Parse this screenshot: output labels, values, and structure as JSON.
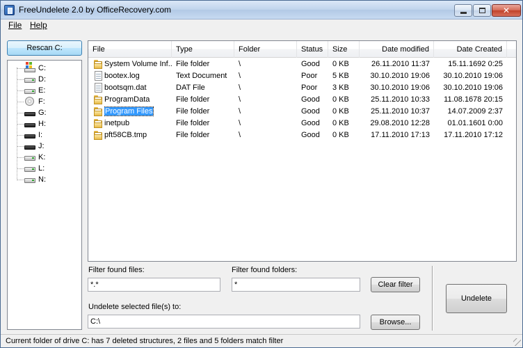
{
  "window": {
    "title": "FreeUndelete 2.0 by OfficeRecovery.com",
    "accent": "#3399ff"
  },
  "menu": {
    "file": "File",
    "help": "Help"
  },
  "left": {
    "rescan_label": "Rescan C:",
    "drives": [
      {
        "label": "C:",
        "icon": "windows-drive-icon"
      },
      {
        "label": "D:",
        "icon": "hard-drive-icon"
      },
      {
        "label": "E:",
        "icon": "hard-drive-icon"
      },
      {
        "label": "F:",
        "icon": "cd-drive-icon"
      },
      {
        "label": "G:",
        "icon": "removable-drive-icon"
      },
      {
        "label": "H:",
        "icon": "removable-drive-icon"
      },
      {
        "label": "I:",
        "icon": "removable-drive-icon"
      },
      {
        "label": "J:",
        "icon": "removable-drive-icon"
      },
      {
        "label": "K:",
        "icon": "hard-drive-icon"
      },
      {
        "label": "L:",
        "icon": "hard-drive-icon"
      },
      {
        "label": "N:",
        "icon": "hard-drive-icon"
      }
    ]
  },
  "table": {
    "columns": [
      "File",
      "Type",
      "Folder",
      "Status",
      "Size",
      "Date modified",
      "Date Created"
    ],
    "rows": [
      {
        "file": "System Volume Inf...",
        "type": "File folder",
        "folder": "\\",
        "status": "Good",
        "size": "0 KB",
        "modified": "26.11.2010 11:37",
        "created": "15.11.1692  0:25",
        "icon": "folder-icon",
        "selected": false
      },
      {
        "file": "bootex.log",
        "type": "Text Document",
        "folder": "\\",
        "status": "Poor",
        "size": "5 KB",
        "modified": "30.10.2010 19:06",
        "created": "30.10.2010 19:06",
        "icon": "document-icon",
        "selected": false
      },
      {
        "file": "bootsqm.dat",
        "type": "DAT File",
        "folder": "\\",
        "status": "Poor",
        "size": "3 KB",
        "modified": "30.10.2010 19:06",
        "created": "30.10.2010 19:06",
        "icon": "document-icon",
        "selected": false
      },
      {
        "file": "ProgramData",
        "type": "File folder",
        "folder": "\\",
        "status": "Good",
        "size": "0 KB",
        "modified": "25.11.2010 10:33",
        "created": "11.08.1678 20:15",
        "icon": "folder-icon",
        "selected": false
      },
      {
        "file": "Program Files",
        "type": "File folder",
        "folder": "\\",
        "status": "Good",
        "size": "0 KB",
        "modified": "25.11.2010 10:37",
        "created": "14.07.2009  2:37",
        "icon": "folder-icon",
        "selected": true
      },
      {
        "file": "inetpub",
        "type": "File folder",
        "folder": "\\",
        "status": "Good",
        "size": "0 KB",
        "modified": "29.08.2010 12:28",
        "created": "01.01.1601  0:00",
        "icon": "folder-icon",
        "selected": false
      },
      {
        "file": "pft58CB.tmp",
        "type": "File folder",
        "folder": "\\",
        "status": "Good",
        "size": "0 KB",
        "modified": "17.11.2010 17:13",
        "created": "17.11.2010 17:12",
        "icon": "folder-icon",
        "selected": false
      }
    ]
  },
  "filters": {
    "files_label": "Filter found files:",
    "files_value": "*.*",
    "folders_label": "Filter found folders:",
    "folders_value": "*",
    "clear_label": "Clear filter"
  },
  "undelete": {
    "dest_label": "Undelete selected file(s) to:",
    "dest_value": "C:\\",
    "browse_label": "Browse...",
    "undelete_label": "Undelete"
  },
  "status": {
    "text": "Current folder of drive C: has 7 deleted structures, 2 files and 5 folders match filter"
  }
}
